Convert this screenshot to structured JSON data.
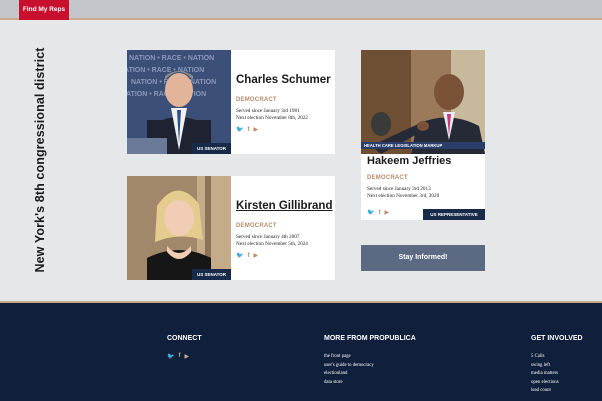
{
  "topbar": {
    "find_label": "Find My Reps"
  },
  "district_title": "New York's 8th congressional district",
  "reps": [
    {
      "name": "Charles Schumer",
      "party": "DEMOCRACT",
      "served": "Served since January 3rd 1981",
      "next_election": "Next election November 8th, 2022",
      "role": "US SENATOR"
    },
    {
      "name": "Kirsten Gillibrand",
      "party": "DEMOCRACT",
      "served": "Served since January 4th 2007",
      "next_election": "Next election November 5th, 2024",
      "role": "US SENATOR"
    },
    {
      "name": "Hakeem Jeffries",
      "party": "DEMOCRACT",
      "served": "Served since January 3rd 2013",
      "next_election": "Next election November 3rd, 2020",
      "role": "US REPRESENTATIVE",
      "photo_caption": "HEALTH CARE LEGISLATION MARKUP"
    }
  ],
  "photo_backdrop_text": "NATION • RACE • NATION",
  "stay_informed_label": "Stay Informed!",
  "footer": {
    "connect_heading": "CONNECT",
    "more_heading": "MORE FROM PROPUBLICA",
    "more_links": [
      "the front page",
      "user's guide to democracy",
      "electionland",
      "data store"
    ],
    "involved_heading": "GET INVOLVED",
    "involved_links": [
      "5 Calls",
      "swing left",
      "media matters",
      "open elections",
      "lead count"
    ]
  },
  "icons": [
    "twitter-icon",
    "facebook-icon",
    "youtube-icon"
  ],
  "colors": {
    "accent_red": "#c8102e",
    "navy": "#0f1f3c",
    "tan": "#b88d6d",
    "button_slate": "#5b6a82"
  }
}
